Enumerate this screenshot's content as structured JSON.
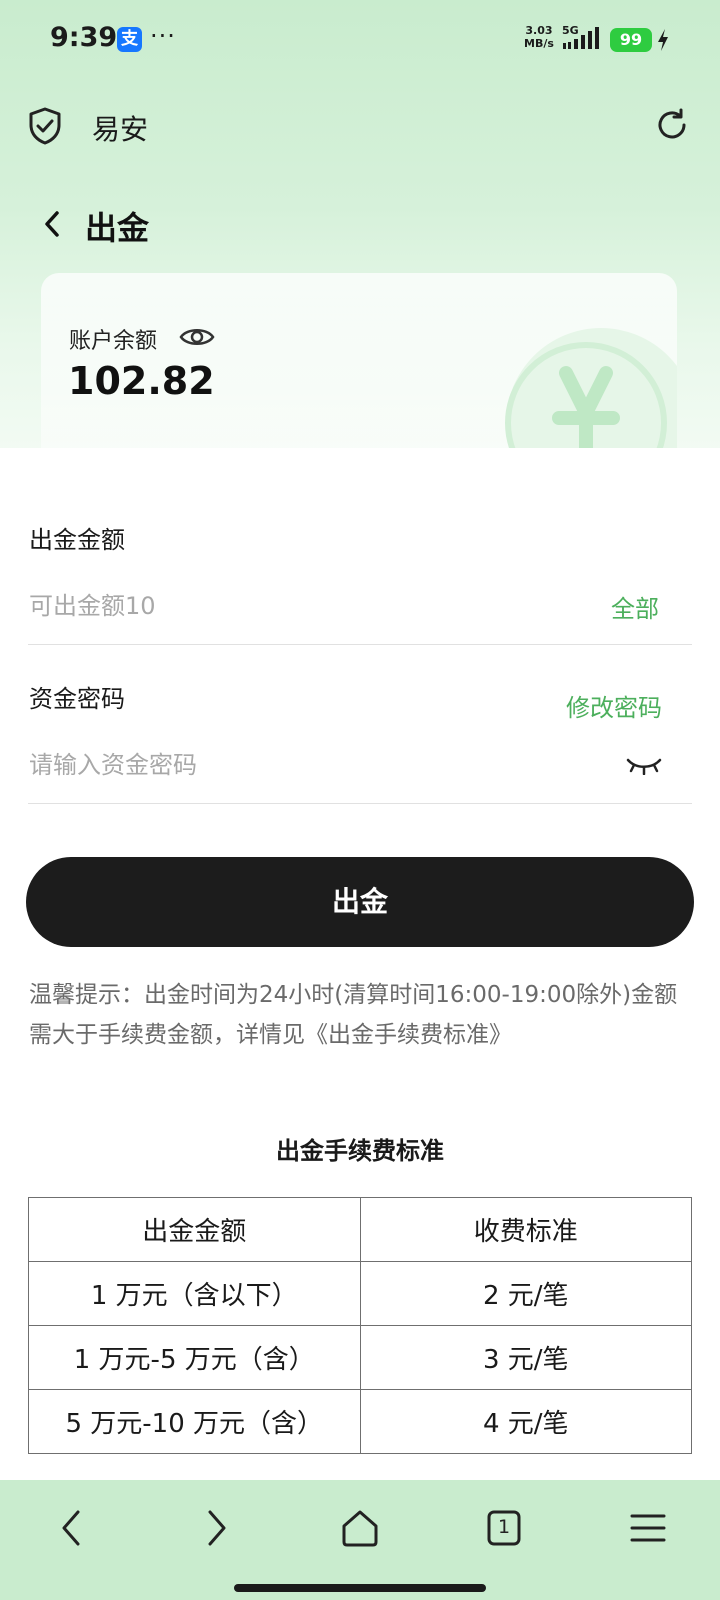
{
  "status_bar": {
    "time": "9:39",
    "alipay_badge": "支",
    "more_dots": "···",
    "net_speed_value": "3.03",
    "net_speed_unit": "MB/s",
    "net_type": "5G",
    "battery": "99"
  },
  "app": {
    "name": "易安"
  },
  "page": {
    "title": "出金"
  },
  "balance": {
    "label": "账户余额",
    "value": "102.82"
  },
  "form": {
    "amount_label": "出金金额",
    "amount_placeholder": "可出金额10",
    "all_button": "全部",
    "password_label": "资金密码",
    "change_password": "修改密码",
    "password_placeholder": "请输入资金密码",
    "submit_label": "出金"
  },
  "tip": "温馨提示：出金时间为24小时(清算时间16:00-19:00除外)金额需大于手续费金额，详情见《出金手续费标准》",
  "fee_table": {
    "title": "出金手续费标准",
    "headers": [
      "出金金额",
      "收费标准"
    ],
    "rows": [
      [
        "1 万元（含以下）",
        "2 元/笔"
      ],
      [
        "1 万元-5 万元（含）",
        "3 元/笔"
      ],
      [
        "5 万元-10 万元（含）",
        "4 元/笔"
      ]
    ]
  },
  "bottom_nav": {
    "tab_count": "1"
  },
  "colors": {
    "accent_green": "#4caf5c",
    "header_bg": "#c9ecce",
    "button_dark": "#1c1c1c"
  }
}
